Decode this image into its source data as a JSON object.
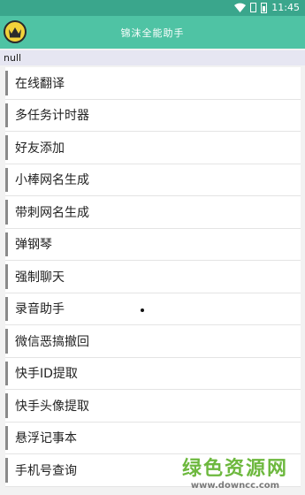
{
  "status_bar": {
    "time": "11:45",
    "icons": [
      "wifi-icon",
      "sim-icon",
      "battery-icon"
    ]
  },
  "app_bar": {
    "title": "锦沫全能助手",
    "logo": "crown-logo"
  },
  "subtitle": "null",
  "menu": {
    "items": [
      {
        "label": "在线翻译"
      },
      {
        "label": "多任务计时器"
      },
      {
        "label": "好友添加"
      },
      {
        "label": "小棒网名生成"
      },
      {
        "label": "带刺网名生成"
      },
      {
        "label": "弹钢琴"
      },
      {
        "label": "强制聊天"
      },
      {
        "label": "录音助手"
      },
      {
        "label": "微信恶搞撤回"
      },
      {
        "label": "快手ID提取"
      },
      {
        "label": "快手头像提取"
      },
      {
        "label": "悬浮记事本"
      },
      {
        "label": "手机号查询"
      }
    ]
  },
  "watermark": {
    "line1": "绿色资源网",
    "line2": "www.downcc.com"
  },
  "colors": {
    "status_bar": "#3aa68c",
    "app_bar": "#4fc3a4",
    "subtitle_bg": "#e6e6f2",
    "item_bar": "#8a8a8a",
    "watermark": "#6db83e"
  }
}
